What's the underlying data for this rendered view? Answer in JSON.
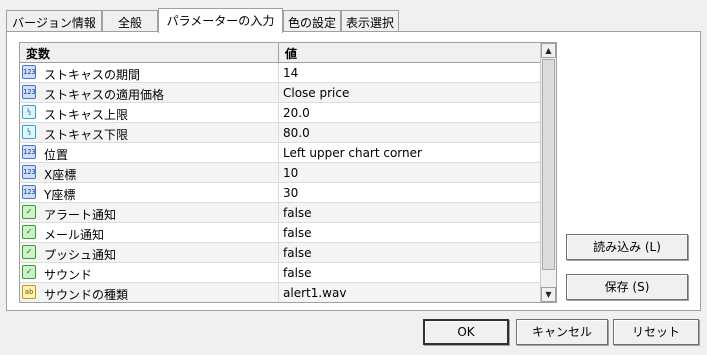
{
  "tabs": [
    "バージョン情報",
    "全般",
    "パラメーターの入力",
    "色の設定",
    "表示選択"
  ],
  "grid": {
    "columns": [
      "変数",
      "値"
    ],
    "rows": [
      {
        "name": "ストキャスの期間",
        "value": "14",
        "icon": "int",
        "glyph": "123"
      },
      {
        "name": "ストキャスの適用価格",
        "value": "Close price",
        "icon": "int",
        "glyph": "123"
      },
      {
        "name": "ストキャス上限",
        "value": "20.0",
        "icon": "dbl",
        "glyph": "½"
      },
      {
        "name": "ストキャス下限",
        "value": "80.0",
        "icon": "dbl",
        "glyph": "½"
      },
      {
        "name": "位置",
        "value": "Left upper chart corner",
        "icon": "int",
        "glyph": "123"
      },
      {
        "name": "X座標",
        "value": "10",
        "icon": "int",
        "glyph": "123"
      },
      {
        "name": "Y座標",
        "value": "30",
        "icon": "int",
        "glyph": "123"
      },
      {
        "name": "アラート通知",
        "value": "false",
        "icon": "bool",
        "glyph": "✓"
      },
      {
        "name": "メール通知",
        "value": "false",
        "icon": "bool",
        "glyph": "✓"
      },
      {
        "name": "プッシュ通知",
        "value": "false",
        "icon": "bool",
        "glyph": "✓"
      },
      {
        "name": "サウンド",
        "value": "false",
        "icon": "bool",
        "glyph": "✓"
      },
      {
        "name": "サウンドの種類",
        "value": "alert1.wav",
        "icon": "str",
        "glyph": "ab"
      }
    ]
  },
  "side_buttons": {
    "load": "読み込み (L)",
    "save": "保存 (S)"
  },
  "footer": {
    "ok": "OK",
    "cancel": "キャンセル",
    "reset": "リセット"
  }
}
